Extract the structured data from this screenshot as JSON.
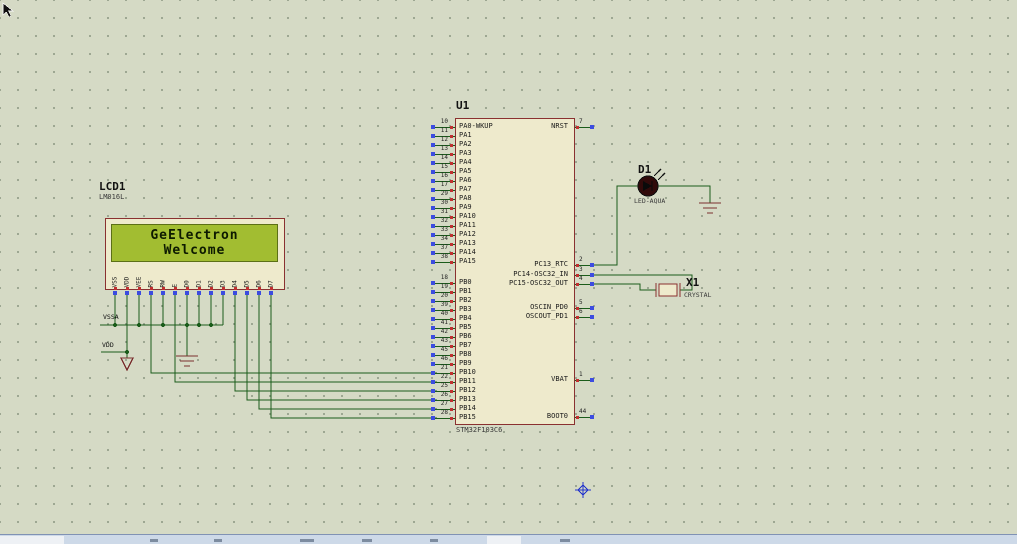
{
  "lcd": {
    "ref": "LCD1",
    "part": "LM016L",
    "screen": {
      "line1": "GeElectron",
      "line2": "Welcome"
    },
    "pins": [
      "VSS",
      "VDD",
      "VEE",
      "RS",
      "RW",
      "E",
      "D0",
      "D1",
      "D2",
      "D3",
      "D4",
      "D5",
      "D6",
      "D7"
    ]
  },
  "mcu": {
    "ref": "U1",
    "part": "STM32F103C6",
    "left_pins": [
      {
        "num": "10",
        "name": "PA0-WKUP"
      },
      {
        "num": "11",
        "name": "PA1"
      },
      {
        "num": "12",
        "name": "PA2"
      },
      {
        "num": "13",
        "name": "PA3"
      },
      {
        "num": "14",
        "name": "PA4"
      },
      {
        "num": "15",
        "name": "PA5"
      },
      {
        "num": "16",
        "name": "PA6"
      },
      {
        "num": "17",
        "name": "PA7"
      },
      {
        "num": "29",
        "name": "PA8"
      },
      {
        "num": "30",
        "name": "PA9"
      },
      {
        "num": "31",
        "name": "PA10"
      },
      {
        "num": "32",
        "name": "PA11"
      },
      {
        "num": "33",
        "name": "PA12"
      },
      {
        "num": "34",
        "name": "PA13"
      },
      {
        "num": "37",
        "name": "PA14"
      },
      {
        "num": "38",
        "name": "PA15"
      },
      {
        "num": "18",
        "name": "PB0"
      },
      {
        "num": "19",
        "name": "PB1"
      },
      {
        "num": "20",
        "name": "PB2"
      },
      {
        "num": "39",
        "name": "PB3"
      },
      {
        "num": "40",
        "name": "PB4"
      },
      {
        "num": "41",
        "name": "PB5"
      },
      {
        "num": "42",
        "name": "PB6"
      },
      {
        "num": "43",
        "name": "PB7"
      },
      {
        "num": "45",
        "name": "PB8"
      },
      {
        "num": "46",
        "name": "PB9"
      },
      {
        "num": "21",
        "name": "PB10"
      },
      {
        "num": "22",
        "name": "PB11"
      },
      {
        "num": "25",
        "name": "PB12"
      },
      {
        "num": "26",
        "name": "PB13"
      },
      {
        "num": "27",
        "name": "PB14"
      },
      {
        "num": "28",
        "name": "PB15"
      }
    ],
    "right_pins": [
      {
        "num": "7",
        "name": "NRST"
      },
      {
        "num": "2",
        "name": "PC13_RTC"
      },
      {
        "num": "3",
        "name": "PC14-OSC32_IN"
      },
      {
        "num": "4",
        "name": "PC15-OSC32_OUT"
      },
      {
        "num": "5",
        "name": "OSCIN_PD0"
      },
      {
        "num": "6",
        "name": "OSCOUT_PD1"
      },
      {
        "num": "1",
        "name": "VBAT"
      },
      {
        "num": "44",
        "name": "BOOT0"
      }
    ]
  },
  "led": {
    "ref": "D1",
    "part": "LED-AQUA"
  },
  "crystal": {
    "ref": "X1",
    "part": "CRYSTAL"
  },
  "net_labels": {
    "gnd": "VSSA",
    "power": "VDD"
  }
}
